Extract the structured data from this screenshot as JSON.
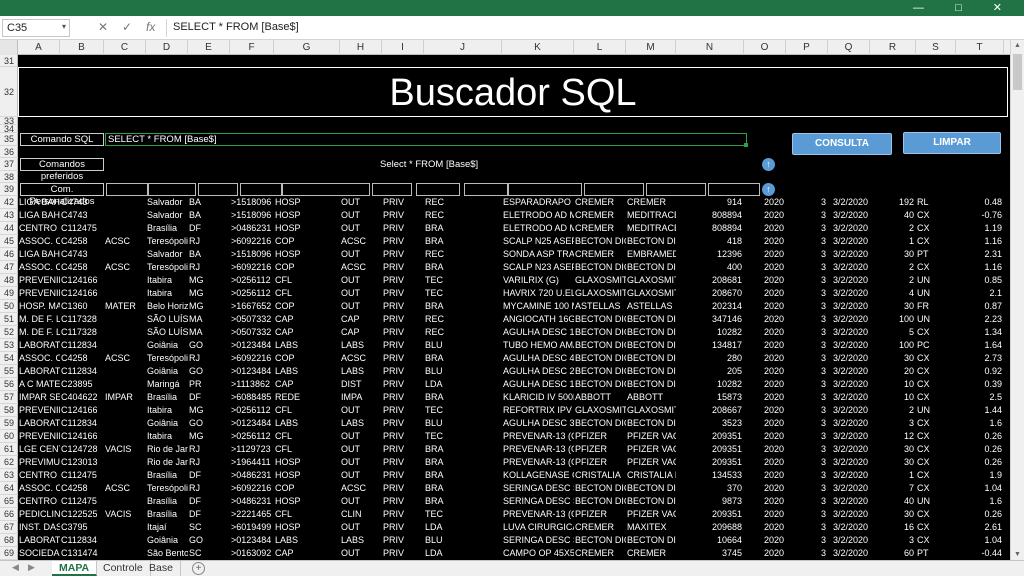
{
  "formula_bar": {
    "name_box": "C35",
    "cancel_glyph": "✕",
    "enter_glyph": "✓",
    "fx_glyph": "fx",
    "formula": "SELECT * FROM  [Base$]"
  },
  "window_controls": "— □ ✕",
  "columns": [
    "A",
    "B",
    "C",
    "D",
    "E",
    "F",
    "G",
    "H",
    "I",
    "J",
    "K",
    "L",
    "M",
    "N",
    "O",
    "P",
    "Q",
    "R",
    "S",
    "T"
  ],
  "rows_top": [
    "31",
    "32",
    "33",
    "34",
    "35",
    "36",
    "37",
    "38",
    "39"
  ],
  "header": {
    "title": "Buscador SQL",
    "comando_label": "Comando SQL",
    "comando_value": "SELECT * FROM  [Base$]",
    "preferidos_label": "Comandos preferidos",
    "favorite_value": "Select * FROM [Base$]",
    "personalizados_label": "Com. Personalizados",
    "consulta_button": "CONSULTA",
    "limpar_button": "LIMPAR"
  },
  "table": {
    "row_numbers": [
      "42",
      "43",
      "44",
      "45",
      "46",
      "47",
      "48",
      "49",
      "50",
      "51",
      "52",
      "53",
      "54",
      "55",
      "56",
      "57",
      "58",
      "59",
      "60",
      "61",
      "62",
      "63",
      "64",
      "65",
      "66",
      "67",
      "68",
      "69"
    ],
    "rows": [
      [
        "LIGA BAHIA",
        "C4743",
        "",
        "Salvador",
        "BA",
        ">1518096",
        "HOSP",
        "OUT",
        "PRIV",
        "REC",
        "ESPARADRAPO 10X",
        "CREMER",
        "CREMER",
        "914",
        "2020",
        "3",
        "3/2/2020",
        "192",
        "RL",
        "0.48"
      ],
      [
        "LIGA BAHIA",
        "C4743",
        "",
        "Salvador",
        "BA",
        ">1518096",
        "HOSP",
        "OUT",
        "PRIV",
        "REC",
        "ELETRODO  AD ME",
        "CREMER",
        "MEDITRACE",
        "808894",
        "2020",
        "3",
        "3/2/2020",
        "40",
        "CX",
        "-0.76"
      ],
      [
        "CENTRO C",
        "C112475",
        "",
        "Brasília",
        "DF",
        ">0486231",
        "HOSP",
        "OUT",
        "PRIV",
        "BRA",
        "ELETRODO  AD ME",
        "CREMER",
        "MEDITRACE",
        "808894",
        "2020",
        "3",
        "3/2/2020",
        "2",
        "CX",
        "1.19"
      ],
      [
        "ASSOC. CC",
        "C4258",
        "ACSC",
        "Teresópolis",
        "RJ",
        ">6092216",
        "COP",
        "ACSC",
        "PRIV",
        "BRA",
        "SCALP N25 ASEPTO",
        "BECTON DIC",
        "BECTON DIC",
        "418",
        "2020",
        "3",
        "3/2/2020",
        "1",
        "CX",
        "1.16"
      ],
      [
        "LIGA BAHIA",
        "C4743",
        "",
        "Salvador",
        "BA",
        ">1518096",
        "HOSP",
        "OUT",
        "PRIV",
        "REC",
        "SONDA ASP TRAQ",
        "CREMER",
        "EMBRAMED",
        "12396",
        "2020",
        "3",
        "3/2/2020",
        "30",
        "PT",
        "2.31"
      ],
      [
        "ASSOC. CC",
        "C4258",
        "ACSC",
        "Teresópolis",
        "RJ",
        ">6092216",
        "COP",
        "ACSC",
        "PRIV",
        "BRA",
        "SCALP N23 ASEPTO",
        "BECTON DIC",
        "BECTON DIC",
        "400",
        "2020",
        "3",
        "3/2/2020",
        "2",
        "CX",
        "1.16"
      ],
      [
        "PREVENIR",
        "C124166",
        "",
        "Itabira",
        "MG",
        ">0256112",
        "CFL",
        "OUT",
        "PRIV",
        "TEC",
        "VARILRIX (G)",
        "GLAXOSMITI",
        "GLAXOSMITI",
        "208681",
        "2020",
        "3",
        "3/2/2020",
        "2",
        "UN",
        "0.85"
      ],
      [
        "PREVENIR",
        "C124166",
        "",
        "Itabira",
        "MG",
        ">0256112",
        "CFL",
        "OUT",
        "PRIV",
        "TEC",
        "HAVRIX 720 U.EL I",
        "GLAXOSMITI",
        "GLAXOSMITI",
        "208670",
        "2020",
        "3",
        "3/2/2020",
        "4",
        "UN",
        "2.1"
      ],
      [
        "HOSP. MA",
        "C1360",
        "MATER",
        "Belo Horizo",
        "MG",
        ">1667652",
        "COP",
        "OUT",
        "PRIV",
        "BRA",
        "MYCAMINE 100 M",
        "ASTELLAS",
        "ASTELLAS",
        "202314",
        "2020",
        "3",
        "3/2/2020",
        "30",
        "FR",
        "0.87"
      ],
      [
        "M. DE F. L.",
        "C117328",
        "",
        "SÃO LUÍS",
        "MA",
        ">0507332",
        "CAP",
        "CAP",
        "PRIV",
        "REC",
        "ANGIOCATH 16G E",
        "BECTON DIC",
        "BECTON DIC",
        "347146",
        "2020",
        "3",
        "3/2/2020",
        "100",
        "UN",
        "2.23"
      ],
      [
        "M. DE F. L.",
        "C117328",
        "",
        "SÃO LUÍS",
        "MA",
        ">0507332",
        "CAP",
        "CAP",
        "PRIV",
        "REC",
        "AGULHA DESC 13X",
        "BECTON DIC",
        "BECTON DIC",
        "10282",
        "2020",
        "3",
        "3/2/2020",
        "5",
        "CX",
        "1.34"
      ],
      [
        "LABORATC",
        "C112834",
        "",
        "Goiânia",
        "GO",
        ">0123484",
        "LABS",
        "LABS",
        "PRIV",
        "BLU",
        "TUBO HEMO AMA",
        "BECTON DIC",
        "BECTON DIC",
        "134817",
        "2020",
        "3",
        "3/2/2020",
        "100",
        "PC",
        "1.64"
      ],
      [
        "ASSOC. CC",
        "C4258",
        "ACSC",
        "Teresópolis",
        "RJ",
        ">6092216",
        "COP",
        "ACSC",
        "PRIV",
        "BRA",
        "AGULHA DESC 40X",
        "BECTON DIC",
        "BECTON DIC",
        "280",
        "2020",
        "3",
        "3/2/2020",
        "30",
        "CX",
        "2.73"
      ],
      [
        "LABORATC",
        "C112834",
        "",
        "Goiânia",
        "GO",
        ">0123484",
        "LABS",
        "LABS",
        "PRIV",
        "BLU",
        "AGULHA DESC 25X",
        "BECTON DIC",
        "BECTON DIC",
        "205",
        "2020",
        "3",
        "3/2/2020",
        "20",
        "CX",
        "0.92"
      ],
      [
        "A C MATEI",
        "C23895",
        "",
        "Maringá",
        "PR",
        ">1113862",
        "CAP",
        "DIST",
        "PRIV",
        "LDA",
        "AGULHA DESC 13X",
        "BECTON DIC",
        "BECTON DIC",
        "10282",
        "2020",
        "3",
        "3/2/2020",
        "10",
        "CX",
        "0.39"
      ],
      [
        "IMPAR SEF",
        "C404622",
        "IMPAR",
        "Brasília",
        "DF",
        ">6088485",
        "REDE",
        "IMPA",
        "PRIV",
        "BRA",
        "KLARICID IV 500M",
        "ABBOTT",
        "ABBOTT",
        "15873",
        "2020",
        "3",
        "3/2/2020",
        "10",
        "CX",
        "2.5"
      ],
      [
        "PREVENIR",
        "C124166",
        "",
        "Itabira",
        "MG",
        ">0256112",
        "CFL",
        "OUT",
        "PRIV",
        "TEC",
        "REFORTRIX IPV INI",
        "GLAXOSMITI",
        "GLAXOSMITI",
        "208667",
        "2020",
        "3",
        "3/2/2020",
        "2",
        "UN",
        "1.44"
      ],
      [
        "LABORATC",
        "C112834",
        "",
        "Goiânia",
        "GO",
        ">0123484",
        "LABS",
        "LABS",
        "PRIV",
        "BLU",
        "AGULHA DESC 30X",
        "BECTON DIC",
        "BECTON DIC",
        "3523",
        "2020",
        "3",
        "3/2/2020",
        "3",
        "CX",
        "1.6"
      ],
      [
        "PREVENIR",
        "C124166",
        "",
        "Itabira",
        "MG",
        ">0256112",
        "CFL",
        "OUT",
        "PRIV",
        "TEC",
        "PREVENAR-13 (G)",
        "PFIZER",
        "PFIZER VACI",
        "209351",
        "2020",
        "3",
        "3/2/2020",
        "12",
        "CX",
        "0.26"
      ],
      [
        "LGE CENTI",
        "C124728",
        "VACIS",
        "Rio de Janei",
        "RJ",
        ">1129723",
        "CFL",
        "OUT",
        "PRIV",
        "BRA",
        "PREVENAR-13 (G)",
        "PFIZER",
        "PFIZER VACI",
        "209351",
        "2020",
        "3",
        "3/2/2020",
        "30",
        "CX",
        "0.26"
      ],
      [
        "PREVIMUN",
        "C123013",
        "",
        "Rio de Janei",
        "RJ",
        ">1964411",
        "HOSP",
        "OUT",
        "PRIV",
        "BRA",
        "PREVENAR-13 (G)",
        "PFIZER",
        "PFIZER VACI",
        "209351",
        "2020",
        "3",
        "3/2/2020",
        "30",
        "CX",
        "0.26"
      ],
      [
        "CENTRO C",
        "C112475",
        "",
        "Brasília",
        "DF",
        ">0486231",
        "HOSP",
        "OUT",
        "PRIV",
        "BRA",
        "KOLLAGENASE C/C",
        "CRISTALIA",
        "CRISTALIA B",
        "134533",
        "2020",
        "3",
        "3/2/2020",
        "1",
        "CX",
        "1.9"
      ],
      [
        "ASSOC. CC",
        "C4258",
        "ACSC",
        "Teresópolis",
        "RJ",
        ">6092216",
        "COP",
        "ACSC",
        "PRIV",
        "BRA",
        "SERINGA DESC S/A",
        "BECTON DIC",
        "BECTON DIC",
        "370",
        "2020",
        "3",
        "3/2/2020",
        "7",
        "CX",
        "1.04"
      ],
      [
        "CENTRO C",
        "C112475",
        "",
        "Brasília",
        "DF",
        ">0486231",
        "HOSP",
        "OUT",
        "PRIV",
        "BRA",
        "SERINGA DESC S/A",
        "BECTON DIC",
        "BECTON DIC",
        "9873",
        "2020",
        "3",
        "3/2/2020",
        "40",
        "UN",
        "1.6"
      ],
      [
        "PEDICLIN",
        "C122525",
        "VACIS",
        "Brasília",
        "DF",
        ">2221465",
        "CFL",
        "CLIN",
        "PRIV",
        "TEC",
        "PREVENAR-13 (G)",
        "PFIZER",
        "PFIZER VACI",
        "209351",
        "2020",
        "3",
        "3/2/2020",
        "30",
        "CX",
        "0.26"
      ],
      [
        "INST. DAS",
        "C3795",
        "",
        "Itajaí",
        "SC",
        ">6019499",
        "HOSP",
        "OUT",
        "PRIV",
        "LDA",
        "LUVA CIRURGICA I",
        "CREMER",
        "MAXITEX",
        "209688",
        "2020",
        "3",
        "3/2/2020",
        "16",
        "CX",
        "2.61"
      ],
      [
        "LABORATC",
        "C112834",
        "",
        "Goiânia",
        "GO",
        ">0123484",
        "LABS",
        "LABS",
        "PRIV",
        "BLU",
        "SERINGA DESC S/A",
        "BECTON DIC",
        "BECTON DIC",
        "10664",
        "2020",
        "3",
        "3/2/2020",
        "3",
        "CX",
        "1.04"
      ],
      [
        "SOCIEDAD",
        "C131474",
        "",
        "São Bento d",
        "SC",
        ">0163092",
        "CAP",
        "OUT",
        "PRIV",
        "LDA",
        "CAMPO OP 45X50",
        "CREMER",
        "CREMER",
        "3745",
        "2020",
        "3",
        "3/2/2020",
        "60",
        "PT",
        "-0.44"
      ]
    ]
  },
  "tabs": [
    {
      "label": "MAPA",
      "active": true
    },
    {
      "label": "Controle",
      "active": false
    },
    {
      "label": "Base",
      "active": false
    }
  ],
  "colors": {
    "excel_green": "#217346",
    "button_blue": "#5b9bd5",
    "sheet_bg": "#000000"
  }
}
